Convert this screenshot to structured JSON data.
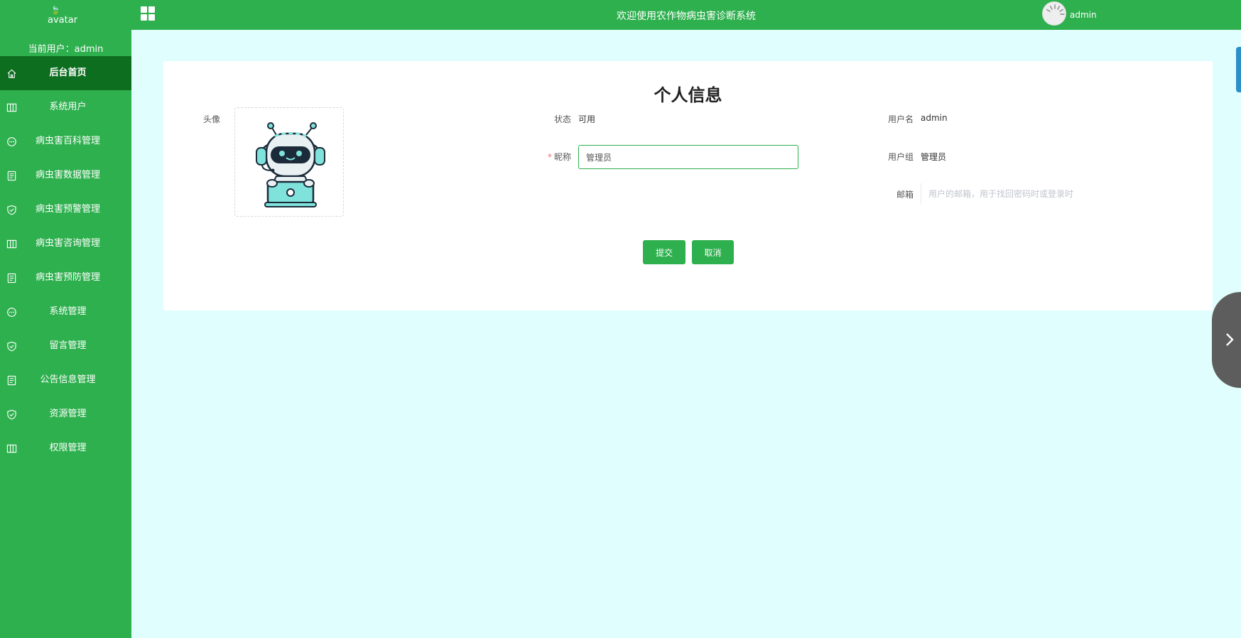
{
  "sidebar": {
    "avatar_alt": "avatar",
    "user_label": "当前用户：",
    "user_name": "admin",
    "items": [
      {
        "label": "后台首页",
        "icon": "home-icon"
      },
      {
        "label": "系统用户",
        "icon": "columns-icon"
      },
      {
        "label": "病虫害百科管理",
        "icon": "chat-icon"
      },
      {
        "label": "病虫害数据管理",
        "icon": "document-icon"
      },
      {
        "label": "病虫害预警管理",
        "icon": "shield-check-icon"
      },
      {
        "label": "病虫害咨询管理",
        "icon": "columns-icon"
      },
      {
        "label": "病虫害预防管理",
        "icon": "document-icon"
      },
      {
        "label": "系统管理",
        "icon": "chat-icon"
      },
      {
        "label": "留言管理",
        "icon": "shield-check-icon"
      },
      {
        "label": "公告信息管理",
        "icon": "document-icon"
      },
      {
        "label": "资源管理",
        "icon": "shield-check-icon"
      },
      {
        "label": "权限管理",
        "icon": "columns-icon"
      }
    ]
  },
  "header": {
    "title": "欢迎使用农作物病虫害诊断系统",
    "user": "admin"
  },
  "profile": {
    "title": "个人信息",
    "avatar_label": "头像",
    "status_label": "状态",
    "status_value": "可用",
    "username_label": "用户名",
    "username_value": "admin",
    "nickname_label": "昵称",
    "nickname_value": "管理员",
    "group_label": "用户组",
    "group_value": "管理员",
    "email_label": "邮箱",
    "email_placeholder": "用户的邮箱，用于找回密码时或登录时",
    "submit_label": "提交",
    "cancel_label": "取消"
  },
  "colors": {
    "brand_green": "#2eb04e",
    "active_menu": "#0d6e1f",
    "page_bg": "#e0fefd"
  }
}
